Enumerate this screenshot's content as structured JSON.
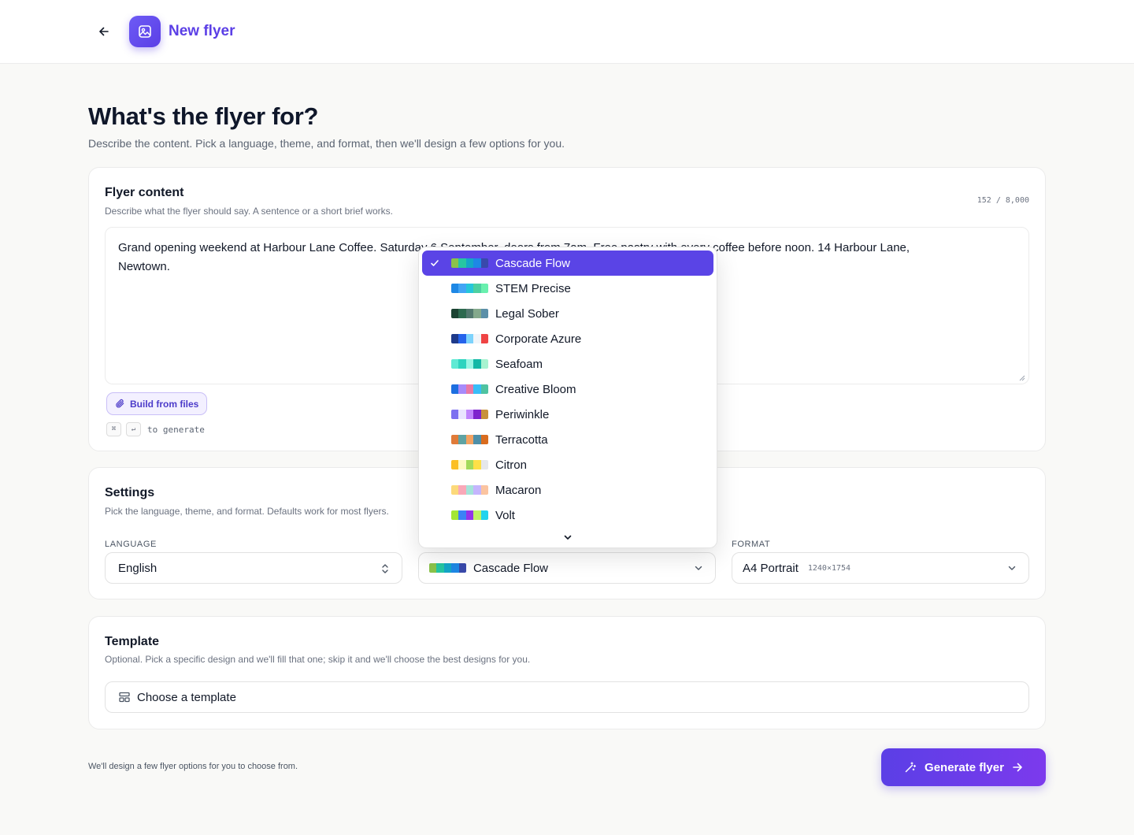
{
  "header": {
    "title": "New flyer",
    "back_icon": "arrow-left-icon",
    "app_icon": "image-icon"
  },
  "page": {
    "title": "What's the flyer for?",
    "subtitle": "Describe the content. Pick a language, theme, and format, then we'll design a few options for you."
  },
  "content_card": {
    "title": "Flyer content",
    "subtitle": "Describe what the flyer should say. A sentence or a short brief works.",
    "counter": "152 / 8,000",
    "text_line1": "Grand opening weekend at Harbour Lane Coffee. Saturday 6 September, doors from 7am. Free pastry with every coffee before noon. 14 Harbour Lane,",
    "text_line2": "Newtown.",
    "build_button": "Build from files",
    "kbd_mod": "⌘",
    "kbd_enter": "↵",
    "kbd_hint": "to generate"
  },
  "settings_card": {
    "title": "Settings",
    "subtitle": "Pick the language, theme, and format. Defaults work for most flyers.",
    "language_label": "LANGUAGE",
    "language_value": "English",
    "theme_value": "Cascade Flow",
    "format_label": "FORMAT",
    "format_value": "A4 Portrait",
    "format_dims": "1240×1754"
  },
  "template_card": {
    "title": "Template",
    "subtitle": "Optional. Pick a specific design and we'll fill that one; skip it and we'll choose the best designs for you.",
    "button": "Choose a template"
  },
  "footer": {
    "note": "We'll design a few flyer options for you to choose from.",
    "generate_button": "Generate flyer"
  },
  "theme_dropdown": {
    "selected": "Cascade Flow",
    "options": [
      {
        "label": "Cascade Flow",
        "colors": [
          "#8bc34a",
          "#26c6a2",
          "#14a6c7",
          "#1e88e5",
          "#3949ab"
        ]
      },
      {
        "label": "STEM Precise",
        "colors": [
          "#1e88e5",
          "#42a5f5",
          "#26c6da",
          "#4dd0a1",
          "#69f0ae"
        ]
      },
      {
        "label": "Legal Sober",
        "colors": [
          "#1b4332",
          "#2d6a4f",
          "#52796f",
          "#84a98c",
          "#5b8fa8"
        ]
      },
      {
        "label": "Corporate Azure",
        "colors": [
          "#1e3a8a",
          "#2563eb",
          "#7dd3fc",
          "#f1f5f9",
          "#ef4444"
        ]
      },
      {
        "label": "Seafoam",
        "colors": [
          "#5eead4",
          "#2dd4bf",
          "#99f6e4",
          "#14b8a6",
          "#a7f3d0"
        ]
      },
      {
        "label": "Creative Bloom",
        "colors": [
          "#1d6fe0",
          "#a78bfa",
          "#e879a6",
          "#38bdf8",
          "#4fc3a1"
        ]
      },
      {
        "label": "Periwinkle",
        "colors": [
          "#7c6ff0",
          "#e9e4ff",
          "#c084fc",
          "#7e22ce",
          "#c8913a"
        ]
      },
      {
        "label": "Terracotta",
        "colors": [
          "#e07b39",
          "#5fa3a3",
          "#f4a261",
          "#4e8fa8",
          "#d96c1f"
        ]
      },
      {
        "label": "Citron",
        "colors": [
          "#fbbf24",
          "#fef9c3",
          "#a3d95b",
          "#fde047",
          "#e5e7eb"
        ]
      },
      {
        "label": "Macaron",
        "colors": [
          "#fcd97a",
          "#f9a8b8",
          "#a5e3d8",
          "#c4b5fd",
          "#fbc4a0"
        ]
      },
      {
        "label": "Volt",
        "colors": [
          "#a3e635",
          "#3b82f6",
          "#9333ea",
          "#bef264",
          "#22d3ee"
        ]
      }
    ]
  }
}
